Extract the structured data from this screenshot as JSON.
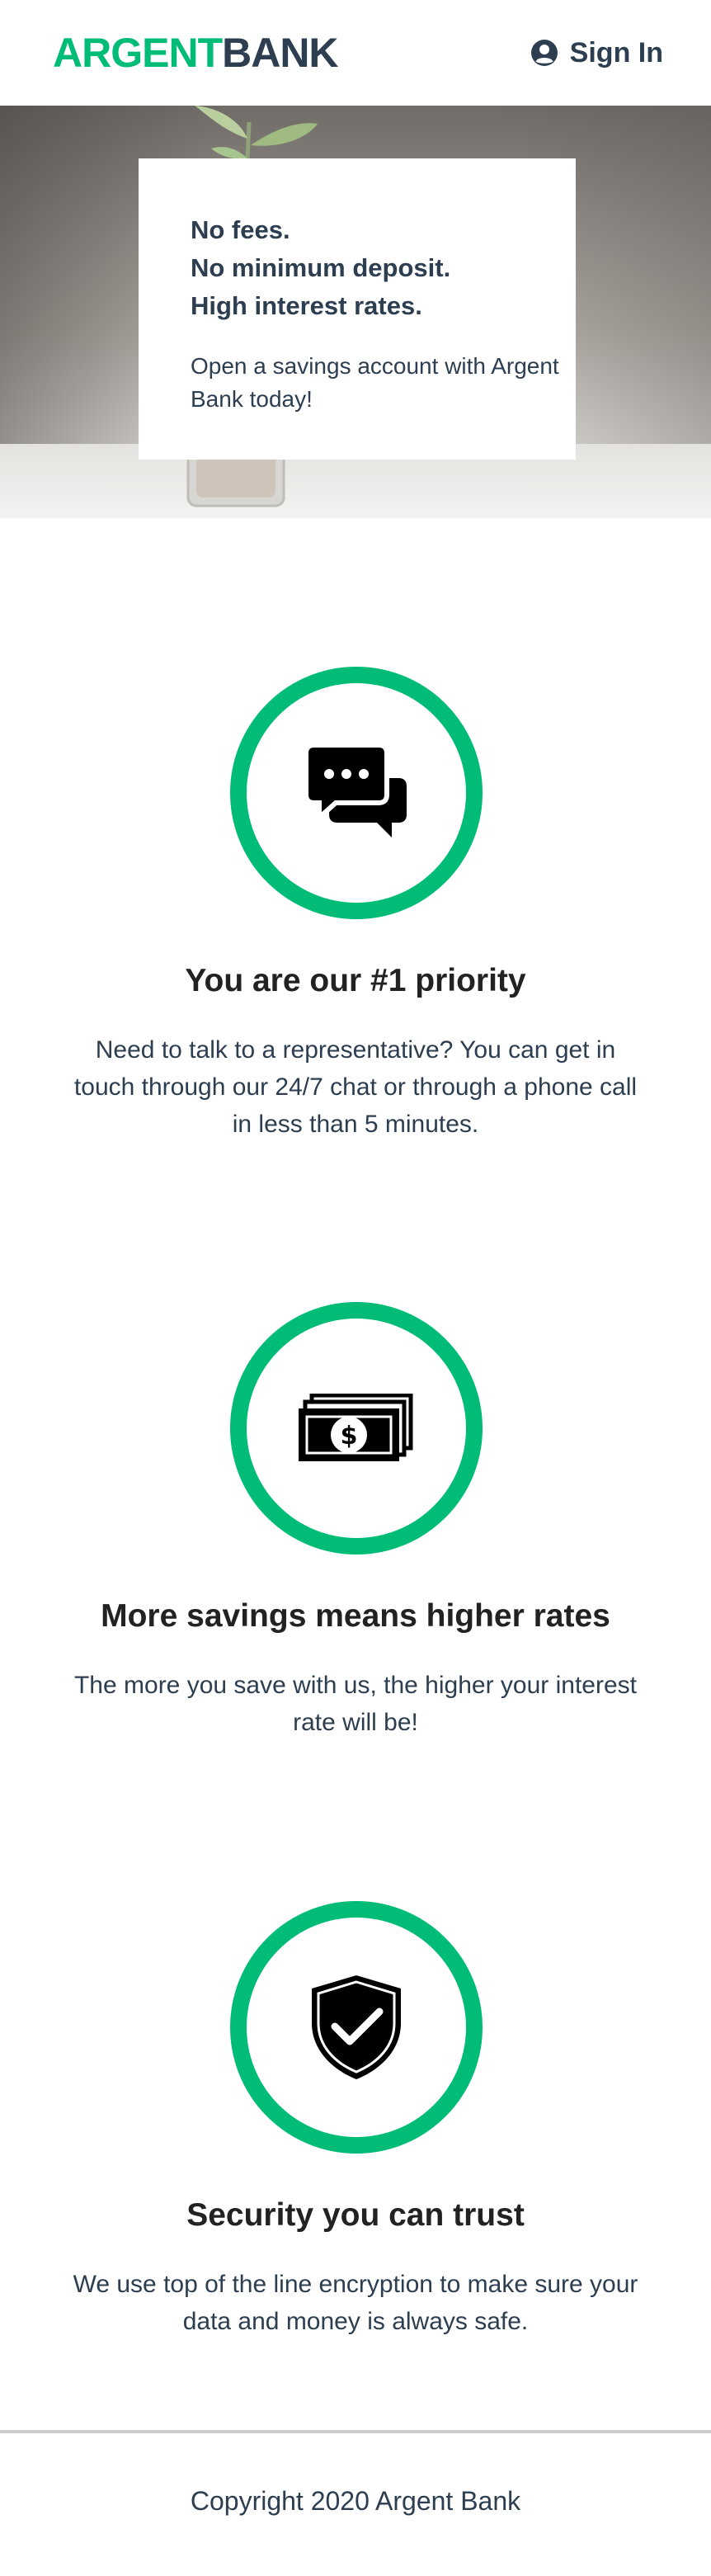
{
  "nav": {
    "logo_part1": "ARGENT",
    "logo_part2": "BANK",
    "signin_label": "Sign In",
    "signin_icon": "user-circle-icon"
  },
  "hero": {
    "subtitles": [
      "No fees.",
      "No minimum deposit.",
      "High interest rates."
    ],
    "text": "Open a savings account with Argent Bank today!"
  },
  "features": [
    {
      "icon": "chat-icon",
      "title": "You are our #1 priority",
      "text": "Need to talk to a representative? You can get in touch through our 24/7 chat or through a phone call in less than 5 minutes."
    },
    {
      "icon": "money-icon",
      "title": "More savings means higher rates",
      "text": "The more you save with us, the higher your interest rate will be!"
    },
    {
      "icon": "security-shield-icon",
      "title": "Security you can trust",
      "text": "We use top of the line encryption to make sure your data and money is always safe."
    }
  ],
  "footer": {
    "copyright": "Copyright 2020 Argent Bank"
  },
  "colors": {
    "brand_green": "#00bc77",
    "text_dark": "#2c3e50"
  }
}
